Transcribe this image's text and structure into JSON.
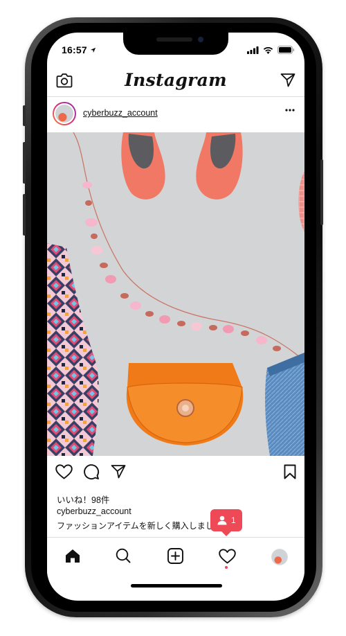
{
  "status_bar": {
    "time": "16:57"
  },
  "app": {
    "logo_text": "Instagram"
  },
  "post": {
    "username": "cyberbuzz_account",
    "likes_text": "いいね！98件",
    "caption_user": "cyberbuzz_account",
    "caption_text": "ファッションアイテムを新しく購入しまし",
    "photo_description_icons": [
      "shoes",
      "necklace",
      "patterned-dress",
      "orange-bag",
      "denim-shorts",
      "straw-hat"
    ]
  },
  "notification": {
    "count": "1"
  },
  "icons": {
    "topbar_left": "camera-icon",
    "topbar_right": "direct-message-icon",
    "post_actions": [
      "heart-icon",
      "comment-icon",
      "share-icon",
      "bookmark-icon"
    ],
    "bottom_nav": [
      "home-icon",
      "search-icon",
      "add-post-icon",
      "activity-heart-icon",
      "profile-avatar"
    ]
  },
  "colors": {
    "accent": "#ed4956",
    "text": "#111111",
    "divider": "#dbdbdb"
  }
}
